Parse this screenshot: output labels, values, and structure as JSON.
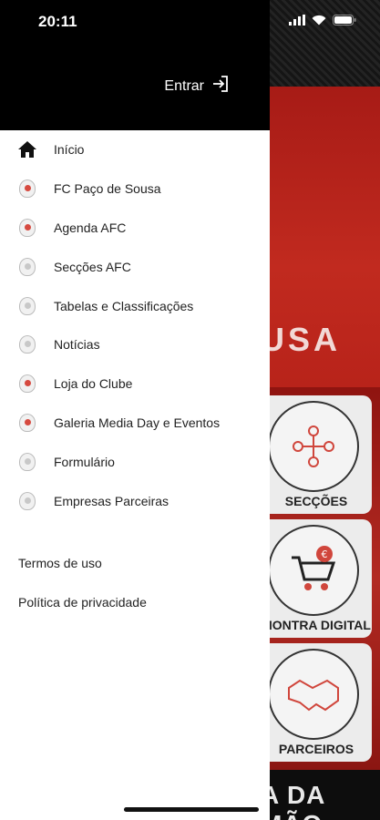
{
  "status_bar": {
    "time": "20:11",
    "icons": [
      "cellular-signal-icon",
      "wifi-icon",
      "battery-icon"
    ]
  },
  "drawer": {
    "login_label": "Entrar",
    "menu_items": [
      {
        "label": "Início",
        "icon": "home-icon"
      },
      {
        "label": "FC Paço de Sousa",
        "icon": "club-crest-icon"
      },
      {
        "label": "Agenda AFC",
        "icon": "club-crest-icon"
      },
      {
        "label": "Secções AFC",
        "icon": "club-crest-icon"
      },
      {
        "label": "Tabelas e Classificações",
        "icon": "club-crest-icon"
      },
      {
        "label": "Notícias",
        "icon": "club-crest-icon"
      },
      {
        "label": "Loja do Clube",
        "icon": "club-crest-icon"
      },
      {
        "label": "Galeria Media Day e Eventos",
        "icon": "club-crest-icon"
      },
      {
        "label": "Formulário",
        "icon": "club-crest-icon"
      },
      {
        "label": "Empresas Parceiras",
        "icon": "club-crest-icon"
      }
    ],
    "footer_links": [
      "Termos de uso",
      "Política de privacidade"
    ]
  },
  "background": {
    "hero_text": "USA",
    "cards": [
      "SECÇÕES",
      "MONTRA DIGITAL",
      "PARCEIROS"
    ],
    "bottom_text": "A DA MÃO"
  },
  "colors": {
    "drawer_header": "#000000",
    "drawer_body": "#ffffff",
    "brand_red": "#b8231a"
  }
}
